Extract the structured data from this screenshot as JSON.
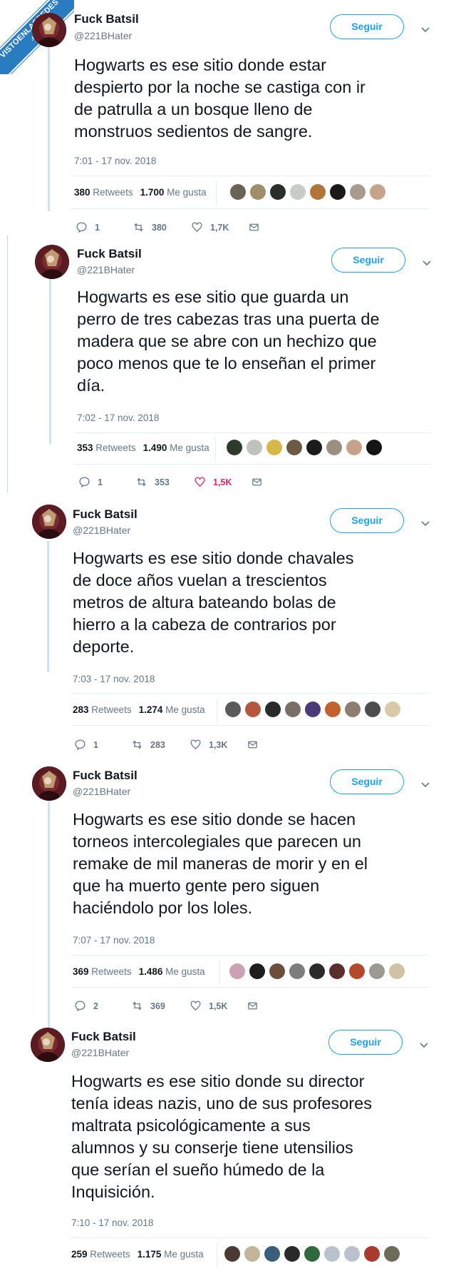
{
  "watermark": {
    "main": "VISTOENLASREDES",
    "sub": ".com"
  },
  "tweets": [
    {
      "name": "Fuck Batsil",
      "handle": "@221BHater",
      "follow_label": "Seguir",
      "text": "Hogwarts es ese sitio donde estar\ndespierto por la noche se castiga con ir\nde patrulla a un bosque lleno de\nmonstruos sedientos de sangre.",
      "time": "7:01 - 17 nov. 2018",
      "retweets": "380",
      "retweets_label": "Retweets",
      "likes": "1.700",
      "likes_label": "Me gusta",
      "replies_count": "1",
      "retweet_count": "380",
      "like_count": "1,7K",
      "liked": false,
      "liker_colors": [
        "#6b6257",
        "#a08d6a",
        "#2b2f2a",
        "#c9cbc8",
        "#b0753a",
        "#191919",
        "#a79a8e",
        "#c7a38b"
      ]
    },
    {
      "name": "Fuck Batsil",
      "handle": "@221BHater",
      "follow_label": "Seguir",
      "text": "Hogwarts es ese sitio que guarda un\nperro de tres cabezas tras una puerta de\nmadera que se abre con un hechizo que\npoco menos que te lo enseñan el primer\ndía.",
      "time": "7:02 - 17 nov. 2018",
      "retweets": "353",
      "retweets_label": "Retweets",
      "likes": "1.490",
      "likes_label": "Me gusta",
      "replies_count": "1",
      "retweet_count": "353",
      "like_count": "1,5K",
      "liked": true,
      "liker_colors": [
        "#2e3a2c",
        "#c0c2bd",
        "#d6b84a",
        "#6d5a44",
        "#1c1c1c",
        "#9d8f80",
        "#c6a28a",
        "#151515"
      ]
    },
    {
      "name": "Fuck Batsil",
      "handle": "@221BHater",
      "follow_label": "Seguir",
      "text": "Hogwarts es ese sitio donde chavales\nde doce años vuelan a trescientos\nmetros de altura bateando bolas de\nhierro a la cabeza de contrarios por\ndeporte.",
      "time": "7:03 - 17 nov. 2018",
      "retweets": "283",
      "retweets_label": "Retweets",
      "likes": "1.274",
      "likes_label": "Me gusta",
      "replies_count": "1",
      "retweet_count": "283",
      "like_count": "1,3K",
      "liked": false,
      "liker_colors": [
        "#5a5a5a",
        "#b5563e",
        "#2a2a2a",
        "#7a6f66",
        "#4b3a78",
        "#c0612e",
        "#8c7f72",
        "#4d4d4d",
        "#d8c9a8"
      ]
    },
    {
      "name": "Fuck Batsil",
      "handle": "@221BHater",
      "follow_label": "Seguir",
      "text": "Hogwarts es ese sitio donde se hacen\ntorneos intercolegiales que parecen un\nremake de mil maneras de morir y en el\nque ha muerto gente pero siguen\nhaciéndolo por los loles.",
      "time": "7:07 - 17 nov. 2018",
      "retweets": "369",
      "retweets_label": "Retweets",
      "likes": "1.486",
      "likes_label": "Me gusta",
      "replies_count": "2",
      "retweet_count": "369",
      "like_count": "1,5K",
      "liked": false,
      "liker_colors": [
        "#caa2b6",
        "#1e1e1e",
        "#6b4f3b",
        "#7d7d7d",
        "#2b2b2b",
        "#5b2e2e",
        "#b34a2c",
        "#9a9a92",
        "#cfc3a6"
      ]
    },
    {
      "name": "Fuck Batsil",
      "handle": "@221BHater",
      "follow_label": "Seguir",
      "text": "Hogwarts es ese sitio donde su director\ntenía ideas nazis, uno de sus profesores\nmaltrata psicológicamente a sus\nalumnos y su conserje tiene utensilios\nque serían el sueño húmedo de la\nInquisición.",
      "time": "7:10 - 17 nov. 2018",
      "retweets": "259",
      "retweets_label": "Retweets",
      "likes": "1.175",
      "likes_label": "Me gusta",
      "liker_colors": [
        "#4a3a33",
        "#c3b49a",
        "#3a5d7a",
        "#2a2a2a",
        "#2f6b3a",
        "#b9c2cc",
        "#b9c2cc",
        "#a83a2e",
        "#6b6b5a"
      ]
    }
  ]
}
